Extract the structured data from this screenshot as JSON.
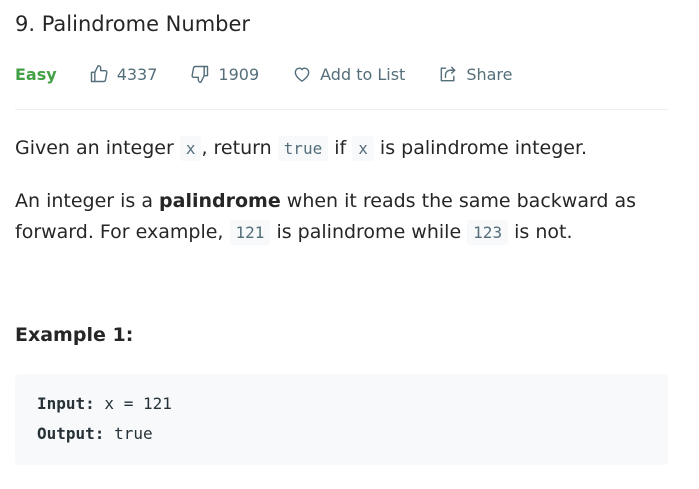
{
  "problem": {
    "title": "9. Palindrome Number",
    "difficulty": "Easy",
    "likes": "4337",
    "dislikes": "1909",
    "add_to_list": "Add to List",
    "share": "Share"
  },
  "description": {
    "p1": {
      "t1": "Given an integer ",
      "c1": "x",
      "t2": ", return ",
      "c2": "true",
      "t3": " if ",
      "c3": "x",
      "t4": " is palindrome integer."
    },
    "p2": {
      "t1": "An integer is a ",
      "bold": "palindrome",
      "t2": " when it reads the same backward as forward. For example, ",
      "c1": "121",
      "t3": " is palindrome while ",
      "c2": "123",
      "t4": " is not."
    }
  },
  "example1": {
    "title": "Example 1:",
    "input_label": "Input:",
    "input_value": " x = 121",
    "output_label": "Output:",
    "output_value": " true"
  },
  "colors": {
    "easy": "#43a047",
    "meta_text": "#546e7a",
    "code_bg": "#f7f9fa"
  },
  "icons": [
    "thumbs-up-icon",
    "thumbs-down-icon",
    "heart-icon",
    "share-icon"
  ]
}
